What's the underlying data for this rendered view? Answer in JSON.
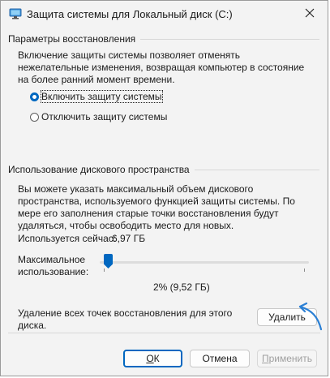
{
  "window": {
    "title": "Защита системы для Локальный диск (C:)",
    "close_icon": "close-icon",
    "app_icon": "computer-icon"
  },
  "restore_settings": {
    "group_title": "Параметры восстановления",
    "description": "Включение защиты системы позволяет отменять нежелательные изменения, возвращая компьютер в состояние на более ранний момент времени.",
    "options": [
      {
        "label": "Включить защиту системы",
        "checked": true
      },
      {
        "label": "Отключить защиту системы",
        "checked": false
      }
    ]
  },
  "disk_usage": {
    "group_title": "Использование дискового пространства",
    "description": "Вы можете указать максимальный объем дискового пространства, используемого функцией защиты системы. По мере его заполнения старые точки восстановления будут удаляться, чтобы освободить место для новых.",
    "current_label": "Используется сейчас:",
    "current_value": "6,97 ГБ",
    "max_label_line1": "Максимальное",
    "max_label_line2": "использование:",
    "slider_percent": 2,
    "slider_value_text": "2% (9,52 ГБ)"
  },
  "delete": {
    "description": "Удаление всех точек восстановления для этого диска.",
    "button_label": "Удалить"
  },
  "footer": {
    "ok_label": "ОК",
    "cancel_label": "Отмена",
    "apply_label": "Применить"
  },
  "colors": {
    "accent": "#0067c0",
    "annotation_arrow": "#2a7fd4"
  }
}
